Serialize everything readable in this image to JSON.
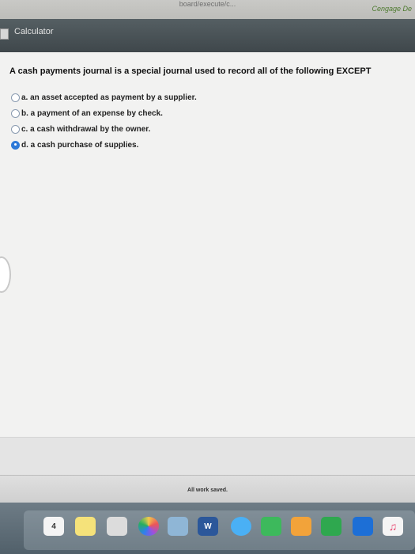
{
  "browser": {
    "url_fragment": "board/execute/c...",
    "brand": "Cengage De"
  },
  "calculator": {
    "label": "Calculator"
  },
  "question": {
    "text": "A cash payments journal is a special journal used to record all of the following EXCEPT",
    "options": [
      {
        "label": "a. an asset accepted as payment by a supplier.",
        "selected": false
      },
      {
        "label": "b. a payment of an expense by check.",
        "selected": false
      },
      {
        "label": "c. a cash withdrawal by the owner.",
        "selected": false
      },
      {
        "label": "d. a cash purchase of supplies.",
        "selected": true
      }
    ],
    "selected_color": "#2f7ad8"
  },
  "status": {
    "saved": "All work saved."
  },
  "dock": {
    "calendar_day": "4",
    "word_letter": "W",
    "icons": [
      "calendar-icon",
      "notes-icon",
      "launcher-icon",
      "photos-icon",
      "preview-icon",
      "word-icon",
      "messages-icon",
      "facetime-icon",
      "pages-icon",
      "numbers-icon",
      "keynote-icon",
      "itunes-icon"
    ]
  }
}
